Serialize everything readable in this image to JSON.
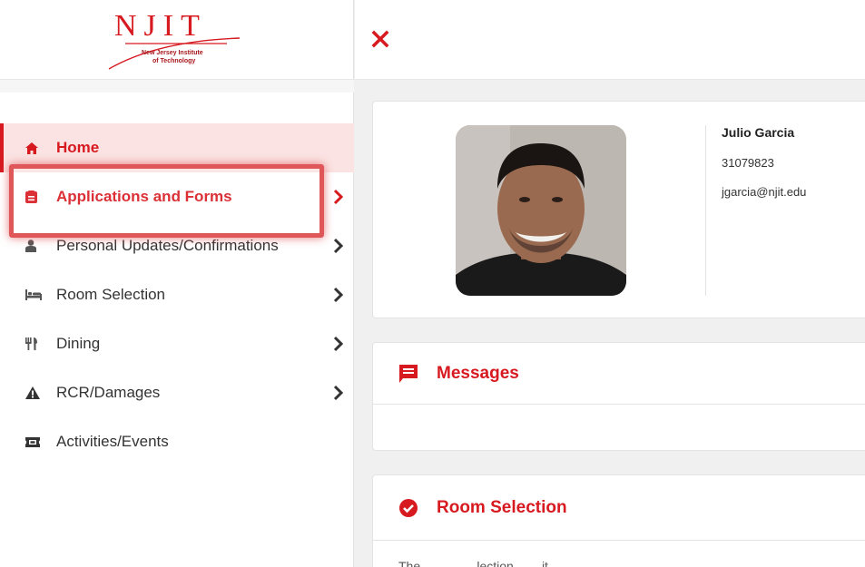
{
  "logo": {
    "letters": "NJIT",
    "subtitle_line1": "New Jersey Institute",
    "subtitle_line2": "of Technology"
  },
  "header": {
    "close_icon": "close-icon"
  },
  "sidebar": {
    "items": [
      {
        "label": "Home",
        "icon": "home-icon",
        "has_chevron": false
      },
      {
        "label": "Applications and Forms",
        "icon": "document-icon",
        "has_chevron": true
      },
      {
        "label": "Personal Updates/Confirmations",
        "icon": "person-icon",
        "has_chevron": true
      },
      {
        "label": "Room Selection",
        "icon": "bed-icon",
        "has_chevron": true
      },
      {
        "label": "Dining",
        "icon": "utensils-icon",
        "has_chevron": true
      },
      {
        "label": "RCR/Damages",
        "icon": "warning-icon",
        "has_chevron": true
      },
      {
        "label": "Activities/Events",
        "icon": "ticket-icon",
        "has_chevron": false
      }
    ]
  },
  "profile": {
    "name": "Julio Garcia",
    "student_id": "31079823",
    "email": "jgarcia@njit.edu"
  },
  "messages": {
    "title": "Messages",
    "icon": "message-icon"
  },
  "room_selection": {
    "title": "Room Selection",
    "icon": "check-circle-icon",
    "text": "The ... ... ... ...lection ... ...it ... ..."
  },
  "colors": {
    "brand_red": "#d71920",
    "active_bg": "#fbe3e3",
    "highlight": "#e0575a"
  }
}
